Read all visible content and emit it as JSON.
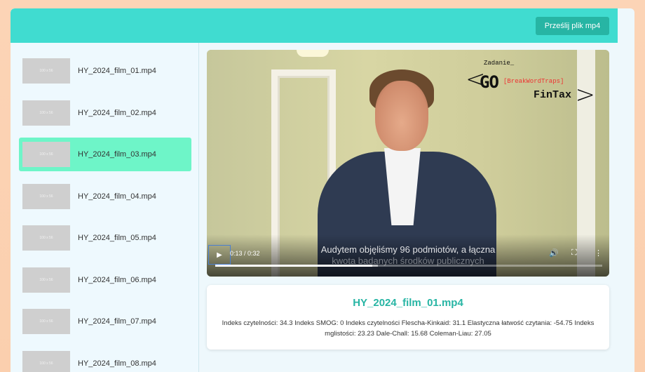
{
  "header": {
    "upload_label": "Prześlij plik mp4"
  },
  "sidebar": {
    "thumb_label": "100 x 56",
    "selected_index": 2,
    "items": [
      {
        "name": "HY_2024_film_01.mp4"
      },
      {
        "name": "HY_2024_film_02.mp4"
      },
      {
        "name": "HY_2024_film_03.mp4"
      },
      {
        "name": "HY_2024_film_04.mp4"
      },
      {
        "name": "HY_2024_film_05.mp4"
      },
      {
        "name": "HY_2024_film_06.mp4"
      },
      {
        "name": "HY_2024_film_07.mp4"
      },
      {
        "name": "HY_2024_film_08.mp4"
      }
    ]
  },
  "player": {
    "watermark": {
      "task": "Zadanie_",
      "go": "GO",
      "tag": "[BreakWordTraps]",
      "brand": "FinTax"
    },
    "subtitle_line1": "Audytem objęliśmy 96 podmiotów, a łączna",
    "subtitle_line2": "kwota badanych środków publicznych",
    "time": "0:13 / 0:32",
    "progress_fraction": 0.40625,
    "buffered_fraction": 0.42,
    "icons": [
      "play-icon",
      "volume-icon",
      "fullscreen-icon",
      "more-icon"
    ]
  },
  "info": {
    "title": "HY_2024_film_01.mp4",
    "metrics": "Indeks czytelności: 34.3 Indeks SMOG: 0 Indeks czytelności Flescha-Kinkaid: 31.1 Elastyczna łatwość czytania: -54.75 Indeks mglistości: 23.23 Dale-Chall: 15.68 Coleman-Liau: 27.05"
  },
  "colors": {
    "accent": "#40dcd0",
    "button": "#27b5a4",
    "selected": "#6ef5c8"
  }
}
